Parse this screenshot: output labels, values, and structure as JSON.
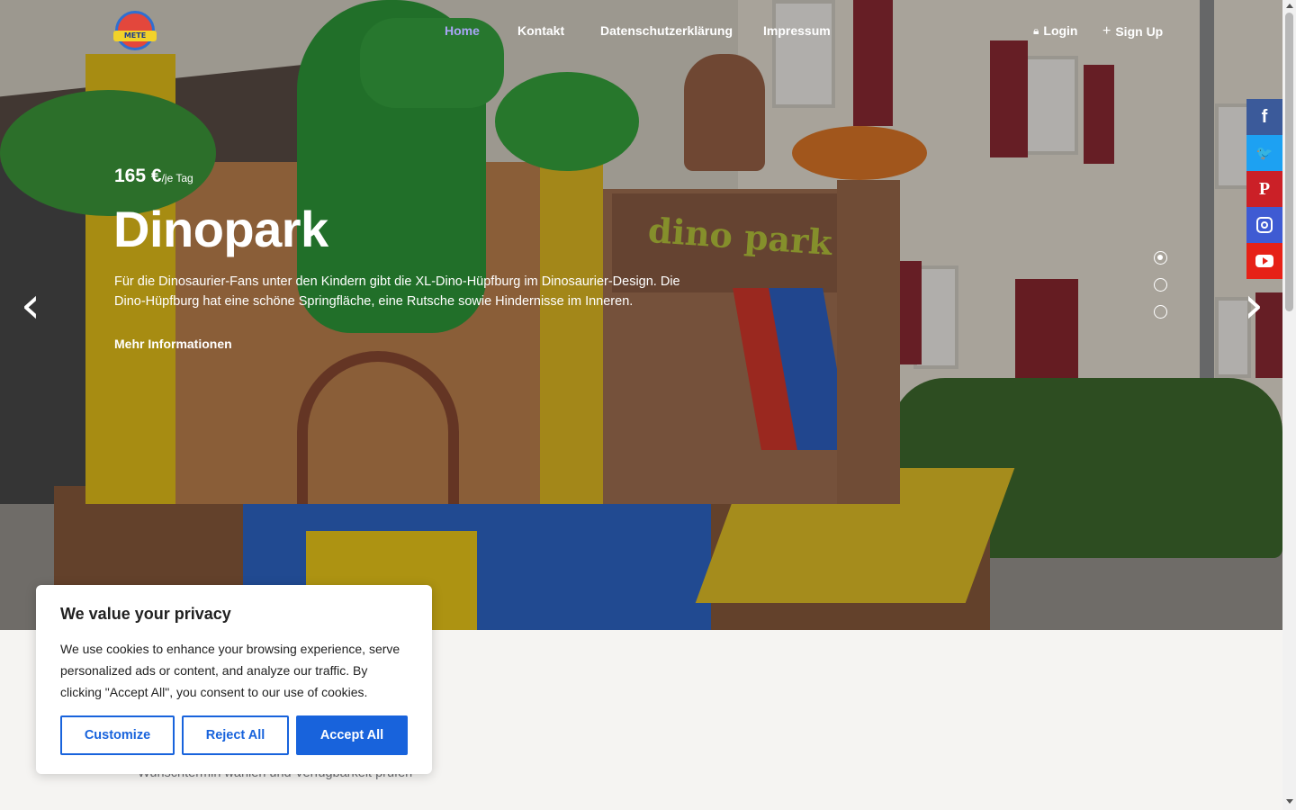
{
  "nav": {
    "logo_text": "METE",
    "links": [
      {
        "label": "Home"
      },
      {
        "label": "Kontakt"
      },
      {
        "label": "Datenschutzerklärung"
      },
      {
        "label": "Impressum"
      }
    ],
    "login_label": "Login",
    "signup_label": "Sign Up",
    "active_link": "Home"
  },
  "hero": {
    "price_amount": "165 €",
    "price_unit": "/je Tag",
    "title": "Dinopark",
    "description": "Für die Dinosaurier-Fans unter den Kindern gibt die XL-Dino-Hüpfburg im Dinosaurier-Design. Die Dino-Hüpfburg hat eine schöne Springfläche, eine Rutsche sowie Hindernisse im Inneren.",
    "more_label": "Mehr Informationen",
    "banner_text": "dino park",
    "slides_total": 3,
    "active_slide": 1
  },
  "social": [
    {
      "name": "facebook",
      "icon": "facebook-icon",
      "glyph": "f",
      "color": "#3b5a9a"
    },
    {
      "name": "twitter",
      "icon": "twitter-icon",
      "glyph": "🐦",
      "color": "#1da1f2"
    },
    {
      "name": "pinterest",
      "icon": "pinterest-icon",
      "glyph": "P",
      "color": "#cb2027"
    },
    {
      "name": "instagram",
      "icon": "instagram-icon",
      "color": "#3f5bd3"
    },
    {
      "name": "youtube",
      "icon": "youtube-icon",
      "color": "#e62117"
    }
  ],
  "below": {
    "text": "Wunschtermin wählen und Verfügbarkeit prüfen"
  },
  "cookie": {
    "title": "We value your privacy",
    "body": "We use cookies to enhance your browsing experience, serve personalized ads or content, and analyze our traffic. By clicking \"Accept All\", you consent to our use of cookies.",
    "customize_label": "Customize",
    "reject_label": "Reject All",
    "accept_label": "Accept All"
  },
  "colors": {
    "accent": "#1863dc",
    "nav_active": "#a9a5f6"
  }
}
